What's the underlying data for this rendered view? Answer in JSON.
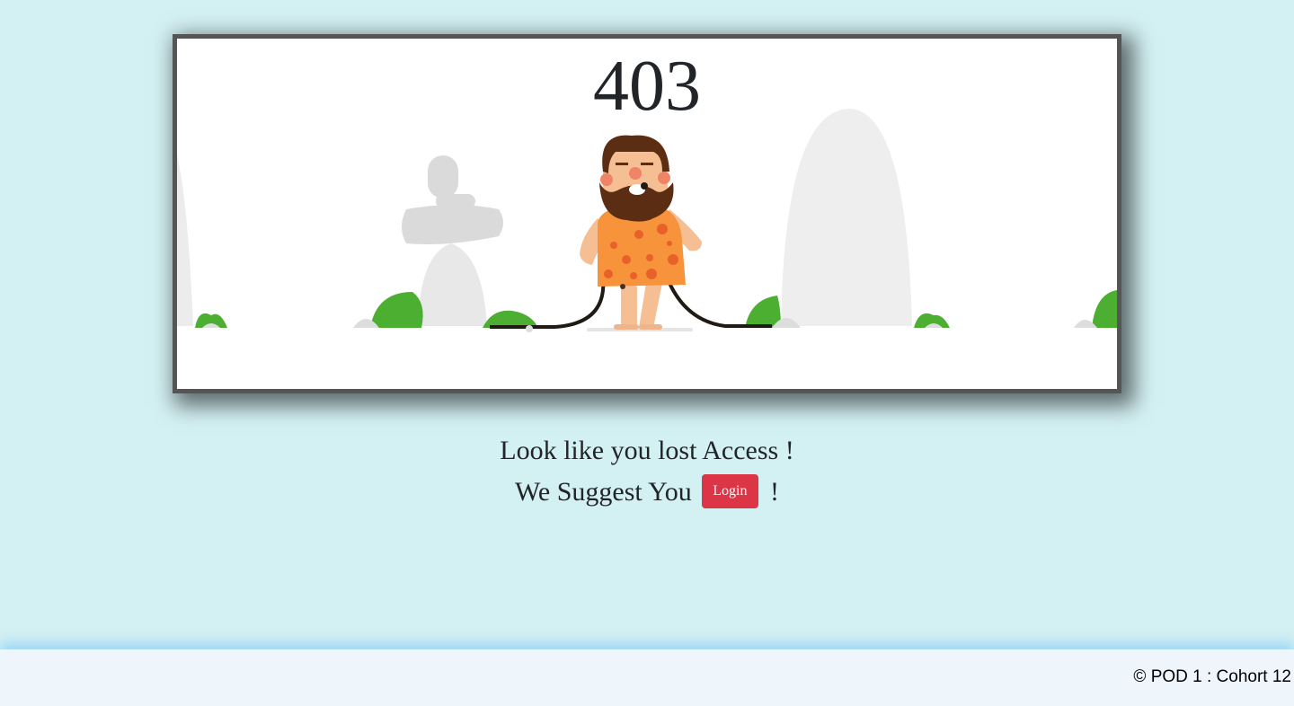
{
  "error": {
    "code": "403"
  },
  "message": {
    "line1": "Look like you lost Access !",
    "line2_prefix": "We Suggest You",
    "line2_suffix": "!",
    "login_label": "Login"
  },
  "footer": {
    "text": "© POD 1 : Cohort 12"
  },
  "colors": {
    "background": "#d3f0f3",
    "button": "#dc3545",
    "footer": "#eef6fc"
  }
}
